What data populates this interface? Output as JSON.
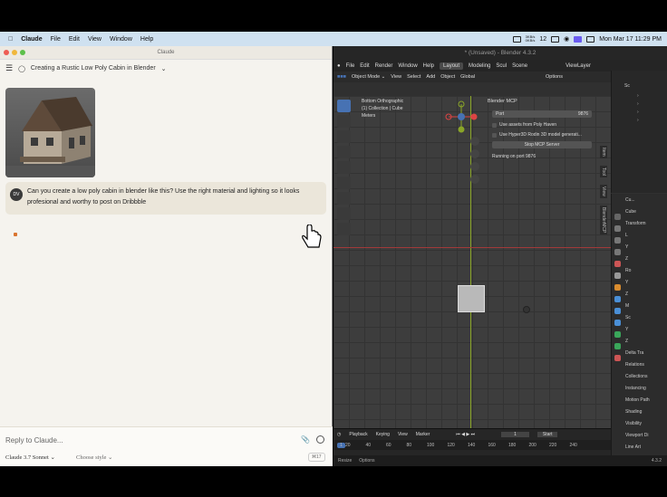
{
  "menubar": {
    "app": "Claude",
    "items": [
      "File",
      "Edit",
      "View",
      "Window",
      "Help"
    ],
    "datetime": "Mon Mar 17  11:29 PM",
    "net_up": "3KB/s",
    "net_down": "0KB/s",
    "badge": "12"
  },
  "claude": {
    "window_title": "Claude",
    "chat_title": "Creating a Rustic Low Poly Cabin in Blender",
    "user_initials": "DV",
    "user_message": "Can you create a low poly cabin in blender like this? Use the right material and lighting so it looks profesional and worthy to post on Dribbble",
    "reply_placeholder": "Reply to Claude...",
    "model": "Claude 3.7 Sonnet",
    "style": "Choose style",
    "token_badge": "⌘17"
  },
  "blender": {
    "window_title": "* (Unsaved) - Blender 4.3.2",
    "menu": [
      "File",
      "Edit",
      "Render",
      "Window",
      "Help"
    ],
    "workspace_tabs": [
      "Layout",
      "Modeling",
      "Scul"
    ],
    "scene": "Scene",
    "view_layer": "ViewLayer",
    "mode": "Object Mode",
    "header_menu": [
      "View",
      "Select",
      "Add",
      "Object"
    ],
    "transform_orientation": "Global",
    "options": "Options",
    "overlay_text": [
      "Bottom Orthographic",
      "(1) Collection | Cube",
      "Meters"
    ],
    "mcp": {
      "title": "Blender MCP",
      "port_label": "Port",
      "port_value": "9876",
      "opt1": "Use assets from Poly Haven",
      "opt2": "Use Hyper3D Rodin 3D model generati...",
      "stop_button": "Stop MCP Server",
      "status": "Running on port 9876"
    },
    "ntabs": [
      "Item",
      "Tool",
      "View",
      "BlenderMCP"
    ],
    "outliner_label": "Sc",
    "props": {
      "object_name": "Cube",
      "header": "Cu...",
      "rows": [
        "Transform",
        "L",
        "Y",
        "Z",
        "Ro",
        "Y",
        "Z",
        "M",
        "Sc",
        "Y",
        "Z",
        "Delta Tra",
        "Relations",
        "Collections",
        "Instancing",
        "Motion Path",
        "Shading",
        "Visibility",
        "Viewport Di",
        "Line Art"
      ]
    },
    "timeline": {
      "menu": [
        "Playback",
        "Keying",
        "View",
        "Marker"
      ],
      "current_frame": "1",
      "start_label": "Start",
      "frames": [
        "1",
        "20",
        "40",
        "60",
        "80",
        "100",
        "120",
        "140",
        "160",
        "180",
        "200",
        "220",
        "240"
      ]
    },
    "status": {
      "left1": "Resize",
      "left2": "Options",
      "version": "4.3.2"
    }
  }
}
